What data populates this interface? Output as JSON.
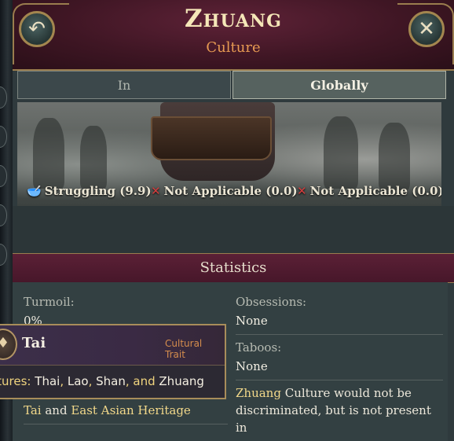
{
  "header": {
    "title": "Zhuang",
    "subtitle": "Culture",
    "back_icon": "back-arrow-icon",
    "close_icon": "close-icon",
    "back_glyph": "↶",
    "close_glyph": "✕"
  },
  "tabs": [
    {
      "label": "In",
      "active": false
    },
    {
      "label": "Globally",
      "active": true
    }
  ],
  "status": [
    {
      "icon": "bowl-icon",
      "glyph": "🥣",
      "text": "Struggling (9.9)"
    },
    {
      "icon": "cross-icon",
      "glyph": "✕",
      "text": "Not Applicable (0.0)"
    },
    {
      "icon": "cross-icon",
      "glyph": "✕",
      "text": "Not Applicable (0.0)"
    }
  ],
  "statistics": {
    "heading": "Statistics",
    "turmoil_label": "Turmoil:",
    "turmoil_value": "0%",
    "obsessions_label": "Obsessions:",
    "obsessions_value": "None",
    "taboos_label": "Taboos:",
    "taboos_value": "None",
    "heritage": {
      "part1": "Tai",
      "joiner": " and ",
      "part2": "East Asian Heritage"
    },
    "note": {
      "culture": "Zhuang",
      "text": " Culture would not be discriminated, but is not present in"
    }
  },
  "tooltip": {
    "name": "Tai",
    "type": "Cultural Trait",
    "icon": "cultural-trait-icon",
    "prefix": "ltures:",
    "cultures": [
      "Thai",
      "Lao",
      "Shan",
      "Zhuang"
    ],
    "sep1": ", ",
    "sep2": ", ",
    "sep3": ", and "
  },
  "colors": {
    "header_bg": "#4a1a2b",
    "gold_border": "#9a7d4e",
    "highlight": "#f2d88a",
    "subtitle": "#e79a52",
    "panel": "#2f3a3d"
  }
}
